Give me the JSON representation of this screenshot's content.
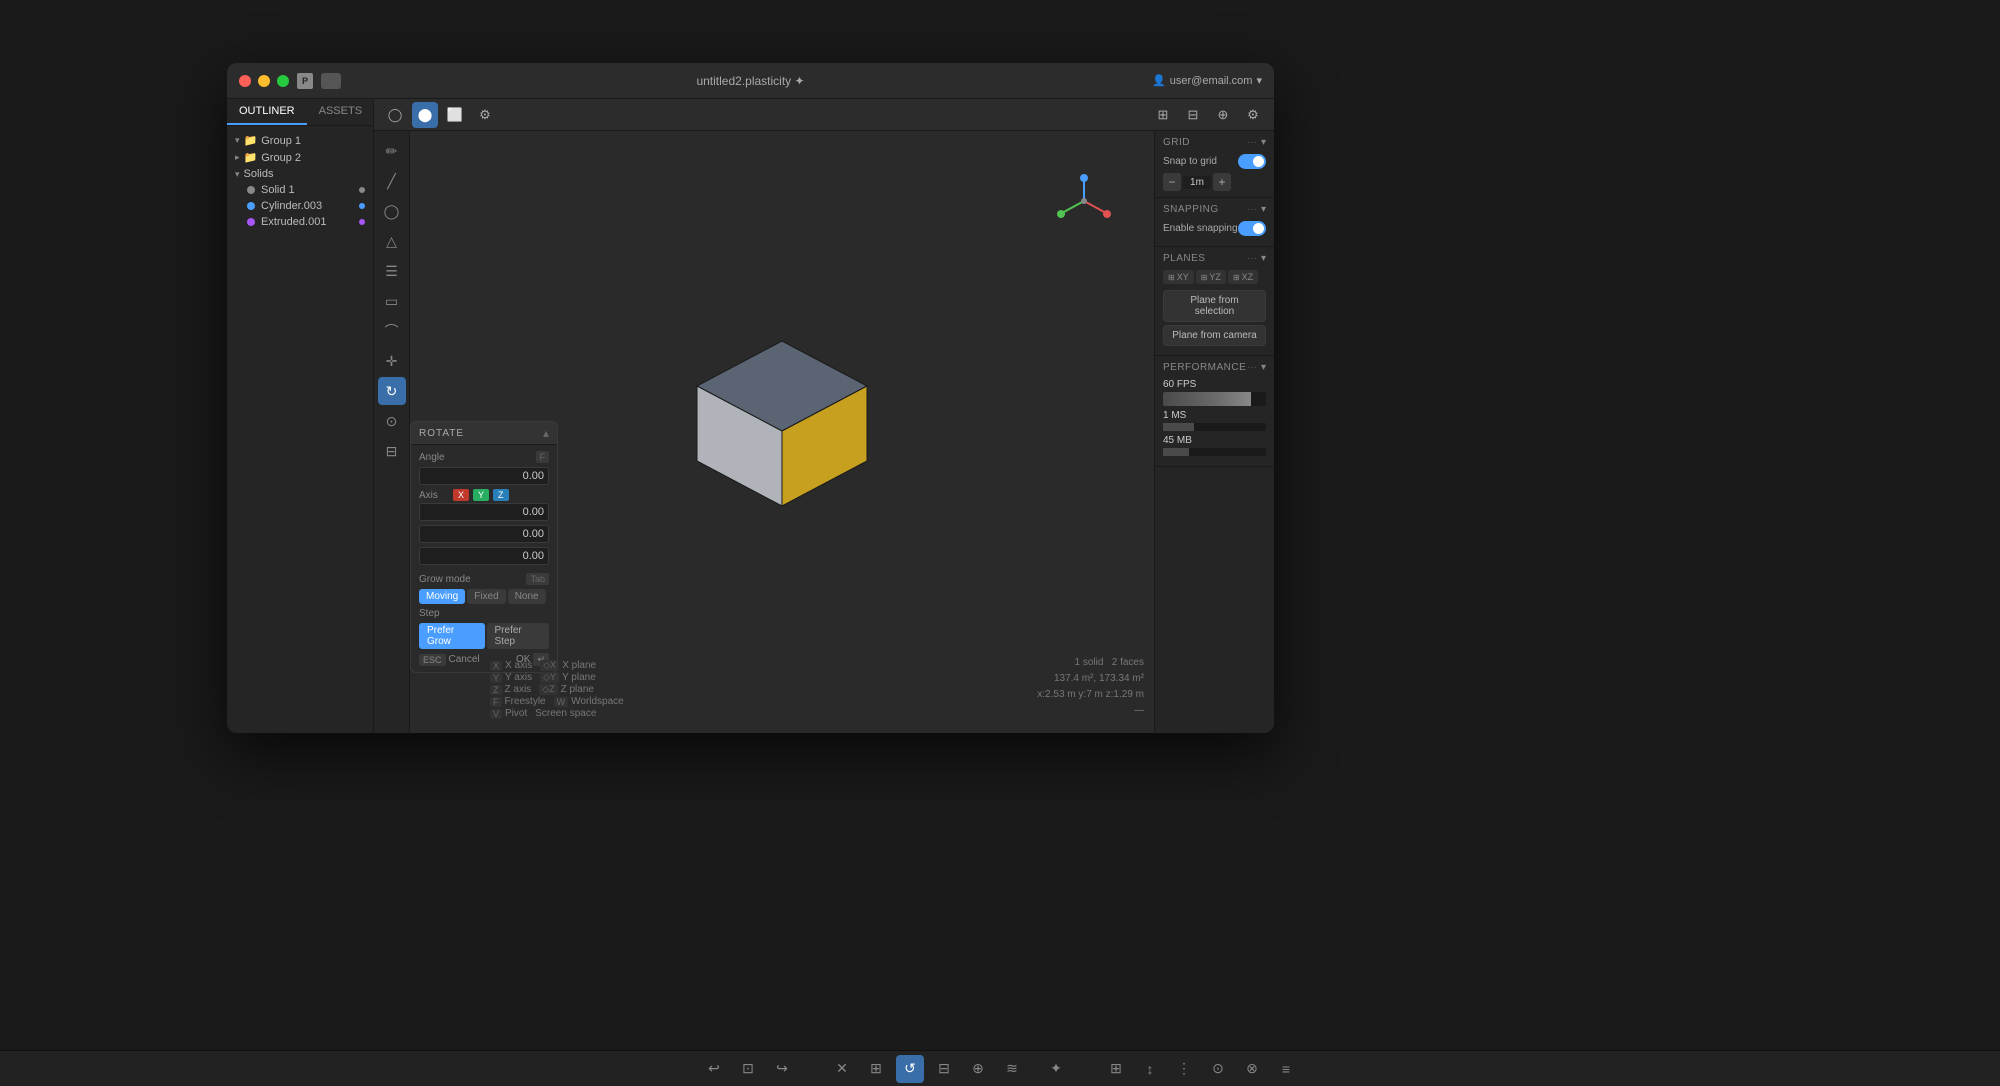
{
  "app": {
    "title": "untitled2.plasticity ✦",
    "user": "user@email.com"
  },
  "titlebar": {
    "app_letter": "P"
  },
  "sidebar": {
    "tabs": [
      {
        "id": "outliner",
        "label": "OUTLINER",
        "active": true
      },
      {
        "id": "assets",
        "label": "ASSETS",
        "active": false
      }
    ],
    "tree": [
      {
        "id": "group1",
        "label": "Group 1",
        "type": "group",
        "indent": 0,
        "expanded": true
      },
      {
        "id": "group2",
        "label": "Group 2",
        "type": "group",
        "indent": 0,
        "expanded": false
      },
      {
        "id": "solids",
        "label": "Solids",
        "type": "category",
        "indent": 0,
        "expanded": true
      },
      {
        "id": "solid1",
        "label": "Solid 1",
        "type": "solid",
        "indent": 1,
        "dot": "white"
      },
      {
        "id": "cylinder003",
        "label": "Cylinder.003",
        "type": "solid",
        "indent": 1,
        "dot": "blue"
      },
      {
        "id": "extruded001",
        "label": "Extruded.001",
        "type": "solid",
        "indent": 1,
        "dot": "purple"
      }
    ]
  },
  "toolbar": {
    "tools": [
      "circle",
      "circle-filled",
      "square",
      "gear"
    ],
    "right_tools": [
      "cursor",
      "multi-cursor",
      "grid",
      "settings"
    ]
  },
  "rotate_panel": {
    "title": "ROTATE",
    "angle_label": "Angle",
    "angle_shortcut": "F",
    "angle_value": "0.00",
    "axis_label": "Axis",
    "axis_x": "X",
    "axis_y": "Y",
    "axis_z": "Z",
    "axis_values": [
      "0.00",
      "0.00",
      "0.00"
    ],
    "grow_mode_label": "Grow mode",
    "grow_mode_shortcut": "Tab",
    "modes": [
      {
        "label": "Moving",
        "active": true
      },
      {
        "label": "Fixed",
        "active": false
      },
      {
        "label": "None",
        "active": false
      }
    ],
    "step_label": "Step",
    "step_btns": [
      {
        "label": "Prefer Grow",
        "active": true
      },
      {
        "label": "Prefer Step",
        "active": false
      }
    ],
    "cancel_label": "Cancel",
    "cancel_key": "ESC",
    "ok_label": "OK",
    "ok_key": "↵"
  },
  "right_panel": {
    "grid_section": {
      "title": "GRID",
      "snap_label": "Snap to grid",
      "snap_enabled": true,
      "step_value": "1m"
    },
    "snapping_section": {
      "title": "SNAPPING",
      "enable_label": "Enable snapping",
      "enabled": true
    },
    "planes_section": {
      "title": "PLANES",
      "planes": [
        {
          "label": "XY"
        },
        {
          "label": "YZ"
        },
        {
          "label": "XZ"
        }
      ],
      "btn1": "Plane from selection",
      "btn2": "Plane from camera"
    },
    "performance_section": {
      "title": "PERFORMANCE",
      "fps_label": "60 FPS",
      "ms_label": "1 MS",
      "mb_label": "45 MB"
    }
  },
  "viewport": {
    "cube": {
      "top_color": "#5a6472",
      "left_color": "#b0b4ba",
      "right_color": "#c8a020"
    }
  },
  "bottom_axis": {
    "left_items": [
      {
        "key": "X",
        "label": "X axis"
      },
      {
        "key": "Y",
        "label": "Y axis"
      },
      {
        "key": "Z",
        "label": "Z axis"
      },
      {
        "key": "F",
        "label": "Freestyle"
      },
      {
        "key": "V",
        "label": "Pivot"
      }
    ],
    "right_items": [
      {
        "key": "◇X",
        "label": "X plane"
      },
      {
        "key": "◇Y",
        "label": "Y plane"
      },
      {
        "key": "◇Z",
        "label": "Z plane"
      },
      {
        "key": "W",
        "label": "Worldspace"
      },
      {
        "key": "",
        "label": "Screen space"
      }
    ]
  },
  "status": {
    "solids": "1 solid",
    "faces": "2 faces",
    "area": "137.4 m², 173.34 m²",
    "coords": "x:2.53 m  y:7 m  z:1.29 m"
  },
  "global_toolbar": {
    "left": [
      "↩",
      "⊡",
      "↪"
    ],
    "center": [
      "✕",
      "⊞",
      "↺",
      "⊟",
      "⊕",
      "≋",
      "✦"
    ],
    "right": [
      "⊞",
      "↕",
      "⋮",
      "⊙",
      "⊗",
      "≡"
    ]
  }
}
